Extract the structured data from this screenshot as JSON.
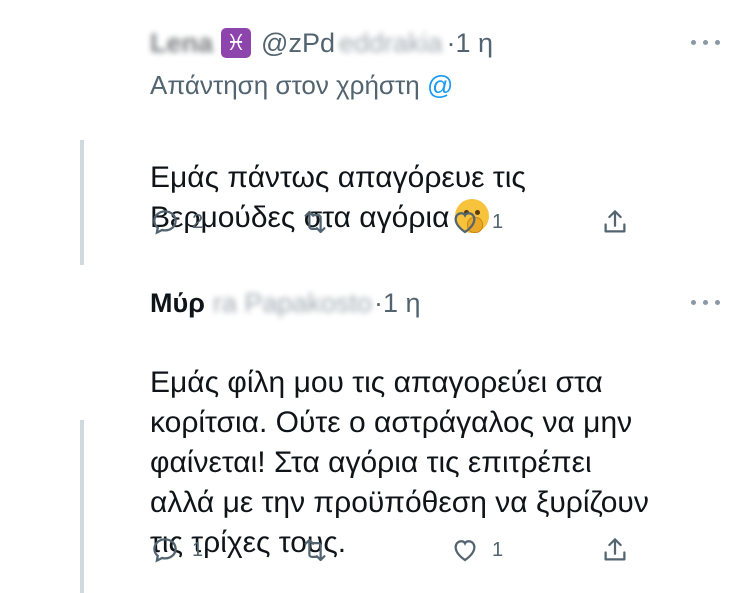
{
  "tweets": [
    {
      "author_name": "Lena",
      "name_emoji": "♓",
      "handle": "@zPd",
      "handle_hidden": "eddrakia",
      "timestamp": "·1 η",
      "reply_to_label": "Απάντηση στον χρήστη",
      "reply_to_handle": "@",
      "body": "Εμάς πάντως απαγόρευε τις\nΒερμούδες στα αγόρια",
      "body_emoji": "shushing-face",
      "stats": {
        "replies": "2",
        "retweets": "",
        "likes": "1"
      }
    },
    {
      "author_name": "Μύρ",
      "name_hidden": "ra Papakosto",
      "timestamp": "·1 η",
      "body": "Εμάς φίλη μου τις απαγορεύει στα\nκορίτσια. Ούτε ο αστράγαλος να μην\nφαίνεται! Στα αγόρια τις επιτρέπει\nαλλά με την προϋπόθεση να ξυρίζουν\nτις τρίχες τους.",
      "stats": {
        "replies": "1",
        "retweets": "",
        "likes": "1"
      }
    }
  ],
  "icons": {
    "reply": "reply-icon",
    "retweet": "retweet-icon",
    "like": "heart-icon",
    "share": "share-icon",
    "more": "more-icon"
  },
  "colors": {
    "text": "#0f1419",
    "secondary": "#536471",
    "thread_line": "#cfd9de",
    "link": "#1d9bf0"
  }
}
